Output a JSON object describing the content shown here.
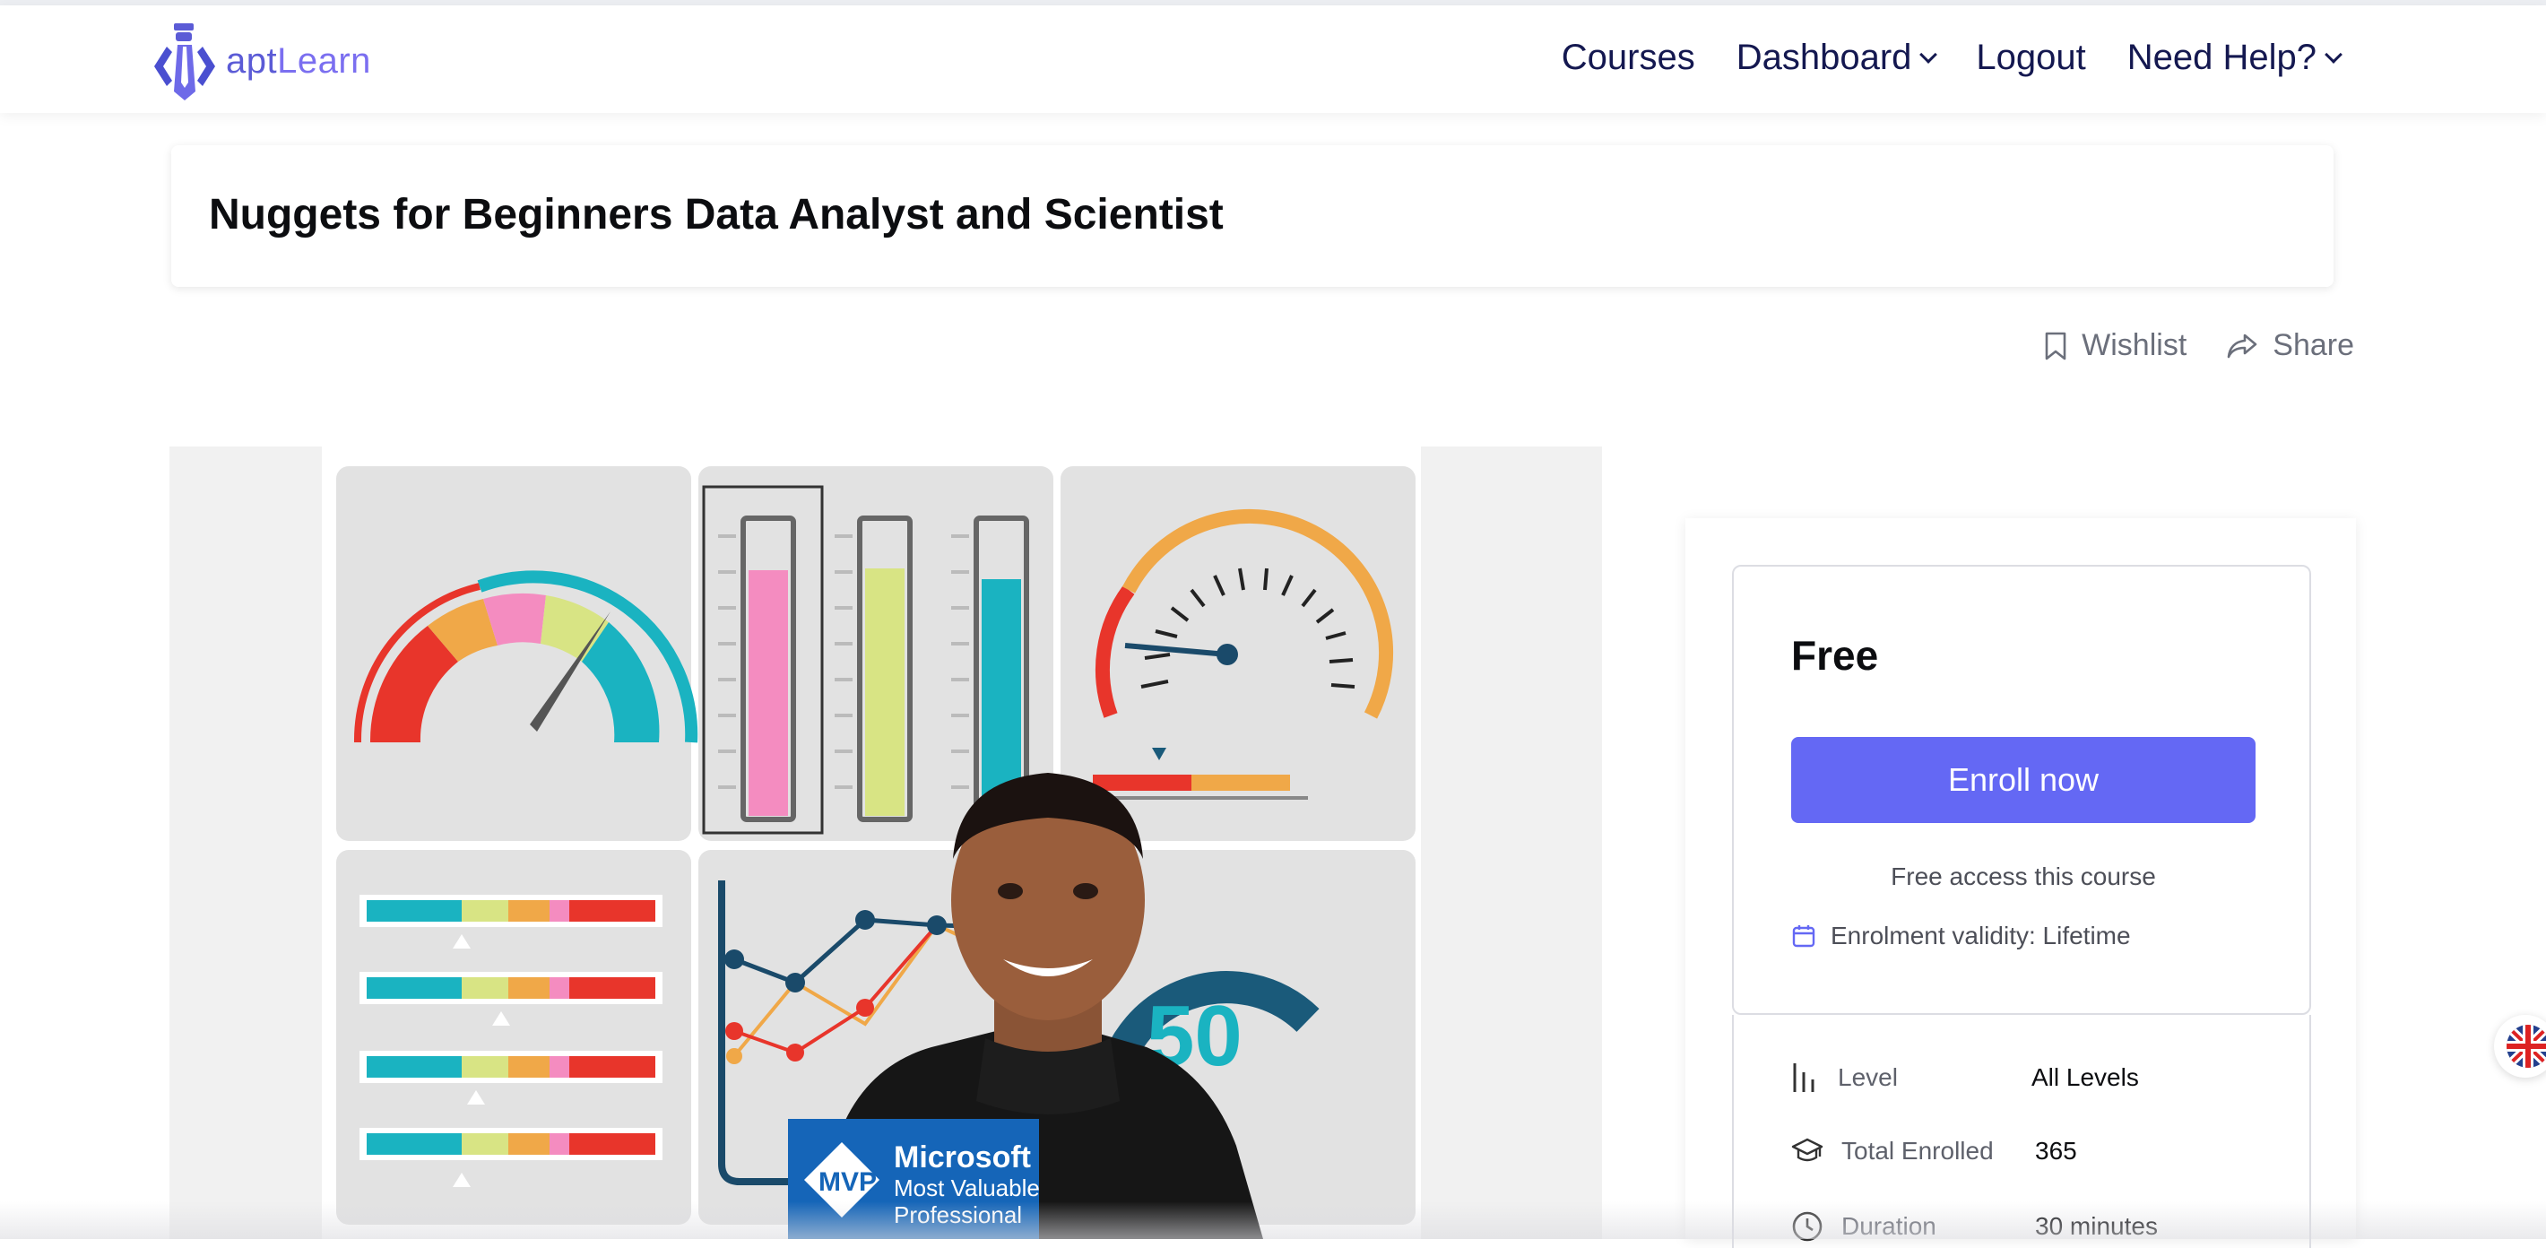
{
  "header": {
    "logo_text_a": "apt",
    "logo_text_b": "Learn",
    "nav": [
      {
        "label": "Courses"
      },
      {
        "label": "Dashboard"
      },
      {
        "label": "Logout"
      },
      {
        "label": "Need Help?"
      }
    ]
  },
  "course": {
    "title": "Nuggets for Beginners Data Analyst and Scientist"
  },
  "actions": {
    "wishlist": "Wishlist",
    "share": "Share"
  },
  "media": {
    "badge_line1": "Microsoft",
    "badge_line2": "Most Valuable",
    "badge_line3": "Professional",
    "badge_mvp": "MVP",
    "gauge_text": "50"
  },
  "sidebar": {
    "price": "Free",
    "enroll_label": "Enroll now",
    "free_access": "Free access this course",
    "validity": "Enrolment validity: Lifetime",
    "info": [
      {
        "icon": "level-bars-icon",
        "label": "Level",
        "value": "All Levels"
      },
      {
        "icon": "graduation-cap-icon",
        "label": "Total Enrolled",
        "value": "365"
      },
      {
        "icon": "clock-icon",
        "label": "Duration",
        "value": "30 minutes"
      }
    ]
  },
  "colors": {
    "brand": "#5b5bd6",
    "nav_text": "#141850",
    "enroll_bg": "#6468f4",
    "red": "#e8352b",
    "orange": "#f0a848",
    "pink": "#f48cc0",
    "lime": "#d8e484",
    "teal": "#1ab3c1",
    "navy": "#1a5a7a"
  }
}
